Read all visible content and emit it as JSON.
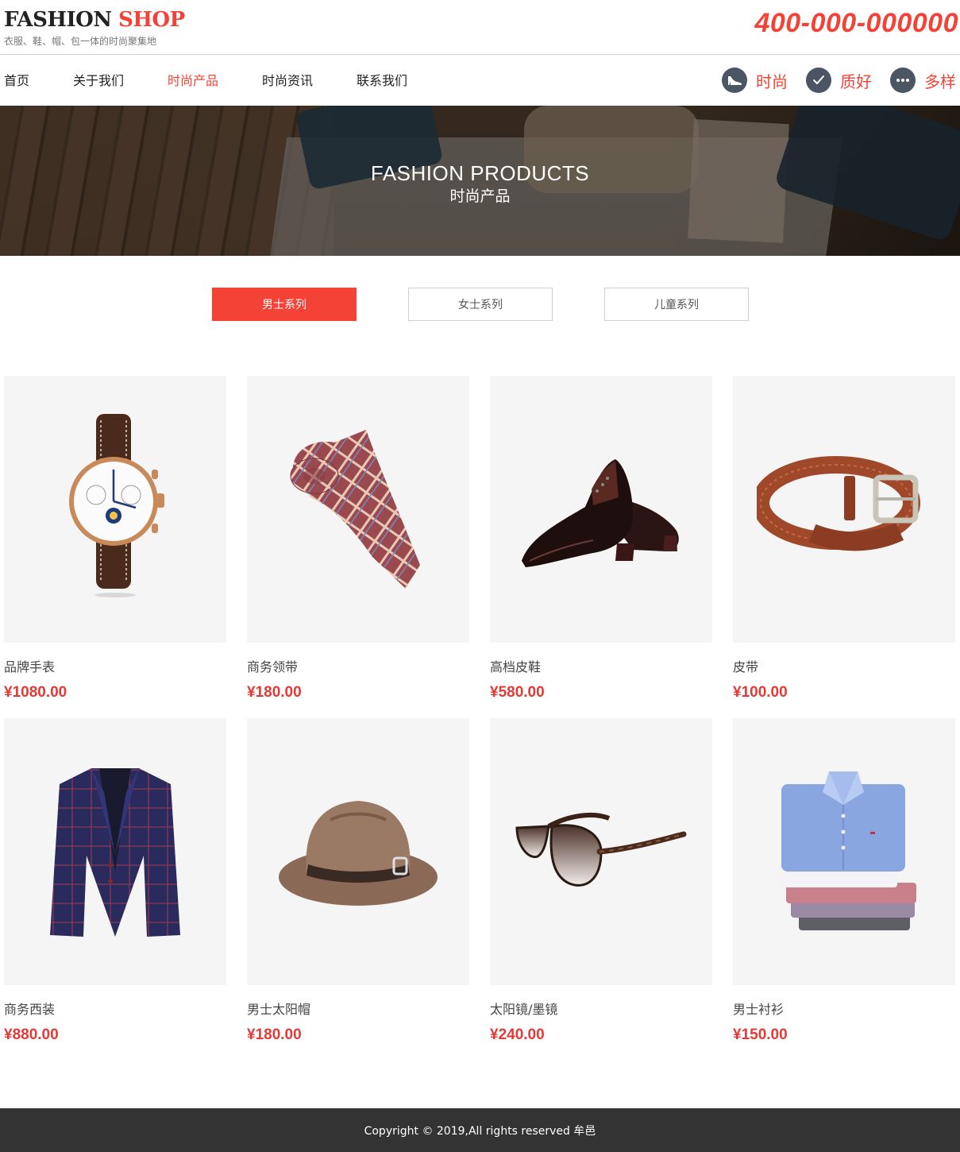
{
  "header": {
    "logo_main": "FASHION",
    "logo_accent": "SHOP",
    "tagline": "衣服、鞋、帽、包一体的时尚聚集地",
    "hotline": "400-000-000000"
  },
  "nav": {
    "items": [
      {
        "label": "首页"
      },
      {
        "label": "关于我们"
      },
      {
        "label": "时尚产品",
        "active": true
      },
      {
        "label": "时尚资讯"
      },
      {
        "label": "联系我们"
      }
    ],
    "features": [
      {
        "icon": "high-heel-icon",
        "label": "时尚"
      },
      {
        "icon": "checkmark-icon",
        "label": "质好"
      },
      {
        "icon": "more-dots-icon",
        "label": "多样"
      }
    ]
  },
  "banner": {
    "title": "FASHION PRODUCTS",
    "subtitle": "时尚产品"
  },
  "tabs": [
    {
      "label": "男士系列",
      "active": true
    },
    {
      "label": "女士系列"
    },
    {
      "label": "儿童系列"
    }
  ],
  "products": [
    {
      "name": "品牌手表",
      "price": "¥1080.00",
      "image": "wristwatch"
    },
    {
      "name": "商务领带",
      "price": "¥180.00",
      "image": "necktie"
    },
    {
      "name": "高档皮鞋",
      "price": "¥580.00",
      "image": "leather-shoes"
    },
    {
      "name": "皮带",
      "price": "¥100.00",
      "image": "belt"
    },
    {
      "name": "商务西装",
      "price": "¥880.00",
      "image": "suit-jacket"
    },
    {
      "name": "男士太阳帽",
      "price": "¥180.00",
      "image": "fedora-hat"
    },
    {
      "name": "太阳镜/墨镜",
      "price": "¥240.00",
      "image": "sunglasses"
    },
    {
      "name": "男士衬衫",
      "price": "¥150.00",
      "image": "folded-shirts"
    }
  ],
  "footer": {
    "copyright": "Copyright © 2019,All rights reserved 牟邑"
  },
  "colors": {
    "accent": "#f44336",
    "price": "#e53935",
    "icon_bg": "#4b5563",
    "footer_bg": "#333333"
  }
}
